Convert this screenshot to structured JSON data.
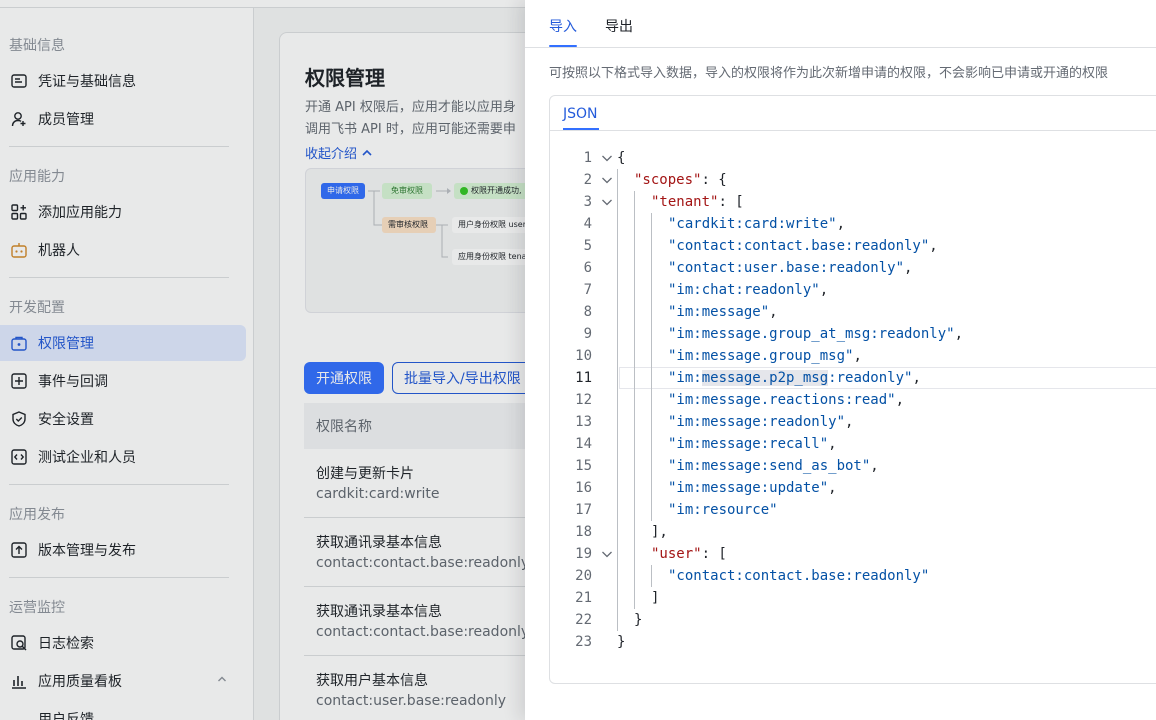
{
  "sidebar": {
    "groups": [
      {
        "title": "基础信息",
        "items": [
          {
            "label": "凭证与基础信息",
            "icon": "credential-icon"
          },
          {
            "label": "成员管理",
            "icon": "member-icon"
          }
        ]
      },
      {
        "title": "应用能力",
        "items": [
          {
            "label": "添加应用能力",
            "icon": "apps-icon"
          },
          {
            "label": "机器人",
            "icon": "robot-icon"
          }
        ]
      },
      {
        "title": "开发配置",
        "items": [
          {
            "label": "权限管理",
            "icon": "permission-icon"
          },
          {
            "label": "事件与回调",
            "icon": "event-icon"
          },
          {
            "label": "安全设置",
            "icon": "shield-icon"
          },
          {
            "label": "测试企业和人员",
            "icon": "code-icon"
          }
        ]
      },
      {
        "title": "应用发布",
        "items": [
          {
            "label": "版本管理与发布",
            "icon": "upload-icon"
          }
        ]
      },
      {
        "title": "运营监控",
        "items": [
          {
            "label": "日志检索",
            "icon": "log-search-icon"
          },
          {
            "label": "应用质量看板",
            "icon": "chart-icon"
          },
          {
            "label": "用户反馈",
            "icon": "feedback-icon"
          }
        ]
      }
    ]
  },
  "main": {
    "title": "权限管理",
    "desc_line1": "开通 API 权限后，应用才能以应用身",
    "desc_line2": "调用飞书 API 时，应用可能还需要申",
    "collapse_label": "收起介绍",
    "flow": {
      "apply": "申请权限",
      "free": "免审权限",
      "success": "权限开通成功,",
      "review": "需审核权限",
      "user_identity": "用户身份权限 user_",
      "app_identity": "应用身份权限 tenan"
    },
    "open_button": "开通权限",
    "bulk_button": "批量导入/导出权限",
    "table_header": "权限名称",
    "rows": [
      {
        "name": "创建与更新卡片",
        "code": "cardkit:card:write"
      },
      {
        "name": "获取通讯录基本信息",
        "code": "contact:contact.base:readonly"
      },
      {
        "name": "获取通讯录基本信息",
        "code": "contact:contact.base:readonly"
      },
      {
        "name": "获取用户基本信息",
        "code": "contact:user.base:readonly"
      }
    ]
  },
  "drawer": {
    "tabs": [
      {
        "label": "导入",
        "active": true
      },
      {
        "label": "导出",
        "active": false
      }
    ],
    "hint": "可按照以下格式导入数据，导入的权限将作为此次新增申请的权限，不会影响已申请或开通的权限",
    "editor_tab": "JSON",
    "current_line": 11,
    "code_lines": [
      {
        "n": "1",
        "indent": 0,
        "fold": true,
        "parts": [
          [
            "p",
            "{"
          ]
        ]
      },
      {
        "n": "2",
        "indent": 1,
        "fold": true,
        "parts": [
          [
            "k",
            "\"scopes\""
          ],
          [
            "p",
            ": {"
          ]
        ]
      },
      {
        "n": "3",
        "indent": 2,
        "fold": true,
        "parts": [
          [
            "k",
            "\"tenant\""
          ],
          [
            "p",
            ": ["
          ]
        ]
      },
      {
        "n": "4",
        "indent": 3,
        "parts": [
          [
            "s",
            "\"cardkit:card:write\""
          ],
          [
            "p",
            ","
          ]
        ]
      },
      {
        "n": "5",
        "indent": 3,
        "parts": [
          [
            "s",
            "\"contact:contact.base:readonly\""
          ],
          [
            "p",
            ","
          ]
        ]
      },
      {
        "n": "6",
        "indent": 3,
        "parts": [
          [
            "s",
            "\"contact:user.base:readonly\""
          ],
          [
            "p",
            ","
          ]
        ]
      },
      {
        "n": "7",
        "indent": 3,
        "parts": [
          [
            "s",
            "\"im:chat:readonly\""
          ],
          [
            "p",
            ","
          ]
        ]
      },
      {
        "n": "8",
        "indent": 3,
        "parts": [
          [
            "s",
            "\"im:message\""
          ],
          [
            "p",
            ","
          ]
        ]
      },
      {
        "n": "9",
        "indent": 3,
        "parts": [
          [
            "s",
            "\"im:message.group_at_msg:readonly\""
          ],
          [
            "p",
            ","
          ]
        ]
      },
      {
        "n": "10",
        "indent": 3,
        "parts": [
          [
            "s",
            "\"im:message.group_msg\""
          ],
          [
            "p",
            ","
          ]
        ]
      },
      {
        "n": "11",
        "indent": 3,
        "parts": [
          [
            "s",
            "\"im:"
          ],
          [
            "sel",
            "message.p2p_msg"
          ],
          [
            "s",
            ":readonly\""
          ],
          [
            "p",
            ","
          ]
        ]
      },
      {
        "n": "12",
        "indent": 3,
        "parts": [
          [
            "s",
            "\"im:message.reactions:read\""
          ],
          [
            "p",
            ","
          ]
        ]
      },
      {
        "n": "13",
        "indent": 3,
        "parts": [
          [
            "s",
            "\"im:message:readonly\""
          ],
          [
            "p",
            ","
          ]
        ]
      },
      {
        "n": "14",
        "indent": 3,
        "parts": [
          [
            "s",
            "\"im:message:recall\""
          ],
          [
            "p",
            ","
          ]
        ]
      },
      {
        "n": "15",
        "indent": 3,
        "parts": [
          [
            "s",
            "\"im:message:send_as_bot\""
          ],
          [
            "p",
            ","
          ]
        ]
      },
      {
        "n": "16",
        "indent": 3,
        "parts": [
          [
            "s",
            "\"im:message:update\""
          ],
          [
            "p",
            ","
          ]
        ]
      },
      {
        "n": "17",
        "indent": 3,
        "parts": [
          [
            "s",
            "\"im:resource\""
          ]
        ]
      },
      {
        "n": "18",
        "indent": 2,
        "parts": [
          [
            "p",
            "],"
          ]
        ]
      },
      {
        "n": "19",
        "indent": 2,
        "fold": true,
        "parts": [
          [
            "k",
            "\"user\""
          ],
          [
            "p",
            ": ["
          ]
        ]
      },
      {
        "n": "20",
        "indent": 3,
        "parts": [
          [
            "s",
            "\"contact:contact.base:readonly\""
          ]
        ]
      },
      {
        "n": "21",
        "indent": 2,
        "parts": [
          [
            "p",
            "]"
          ]
        ]
      },
      {
        "n": "22",
        "indent": 1,
        "parts": [
          [
            "p",
            "}"
          ]
        ]
      },
      {
        "n": "23",
        "indent": 0,
        "parts": [
          [
            "p",
            "}"
          ]
        ]
      }
    ]
  }
}
